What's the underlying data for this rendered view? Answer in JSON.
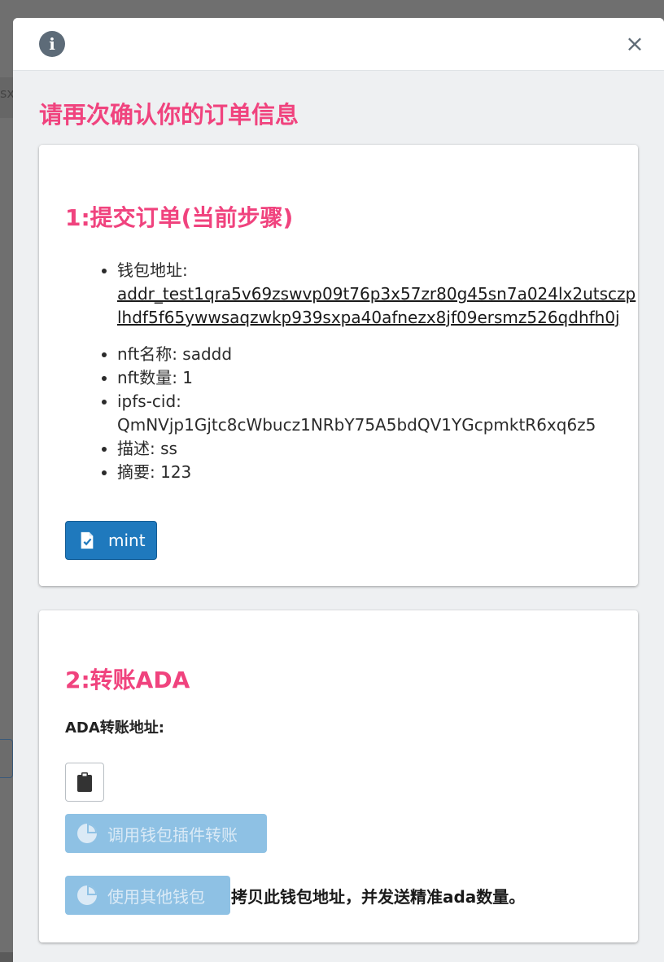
{
  "backdrop": {
    "partial_text": "sx"
  },
  "modal": {
    "info_icon": "info-icon",
    "close_icon": "close-icon",
    "close_glyph": "×",
    "info_glyph": "i",
    "title": "请再次确认你的订单信息"
  },
  "step1": {
    "title": "1:提交订单(当前步骤)",
    "details": {
      "address_label": "钱包地址:",
      "address_value": "addr_test1qra5v69zswvp09t76p3x57zr80g45sn7a024lx2utsczplhdf5f65ywwsaqzwkp939sxpa40afnezx8jf09ersmz526qdhfh0j",
      "nft_name": "nft名称: saddd",
      "nft_count": "nft数量: 1",
      "ipfs_label": "ipfs-cid:",
      "ipfs_value": "QmNVjp1Gjtc8cWbucz1NRbY75A5bdQV1YGcpmktR6xq6z5",
      "description": "描述: ss",
      "summary": "摘要: 123"
    },
    "mint_button": {
      "label": "mint",
      "icon": "file-check-icon"
    }
  },
  "step2": {
    "title": "2:转账ADA",
    "address_label": "ADA转账地址:",
    "clipboard_button": {
      "icon": "clipboard-icon"
    },
    "wallet_plugin_button": {
      "label": "调用钱包插件转账",
      "icon": "pie-chart-icon"
    },
    "other_wallet_button": {
      "label": "使用其他钱包",
      "icon": "pie-chart-icon"
    },
    "copy_note": "拷贝此钱包地址，并发送精准ada数量。"
  },
  "colors": {
    "accent": "#f0437e",
    "primary_button": "#1f79bd",
    "disabled_button": "#8ec1e4",
    "modal_background": "#eef0f2"
  }
}
